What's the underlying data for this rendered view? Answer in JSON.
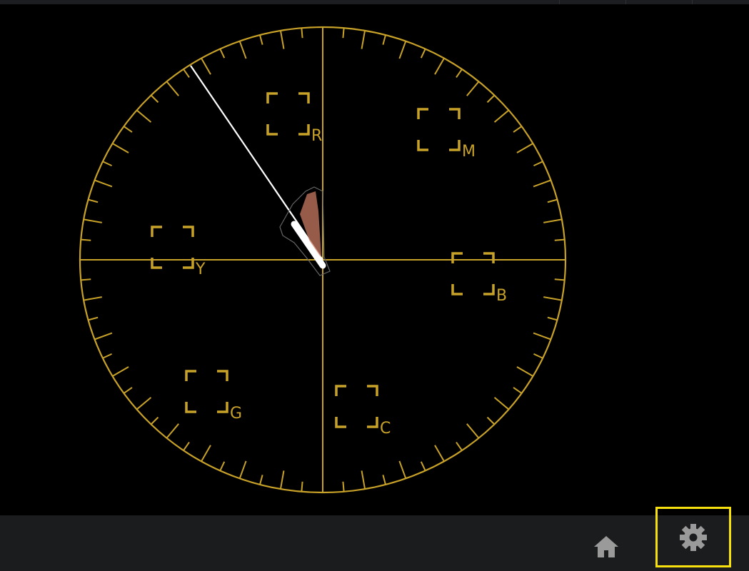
{
  "vectorscope": {
    "colors": {
      "graticule": "#c8a228",
      "trace": "#ffffff",
      "trace_glow": "#c97a62",
      "background": "#000000"
    },
    "targets": [
      {
        "id": "r",
        "label": "R"
      },
      {
        "id": "m",
        "label": "M"
      },
      {
        "id": "y",
        "label": "Y"
      },
      {
        "id": "b",
        "label": "B"
      },
      {
        "id": "g",
        "label": "G"
      },
      {
        "id": "c",
        "label": "C"
      }
    ],
    "skin_tone_line": true
  },
  "toolbar": {
    "home_icon": "home-icon",
    "settings_icon": "gear-icon",
    "settings_highlight_color": "#f6e10f",
    "icon_color": "#9a9a9a"
  }
}
